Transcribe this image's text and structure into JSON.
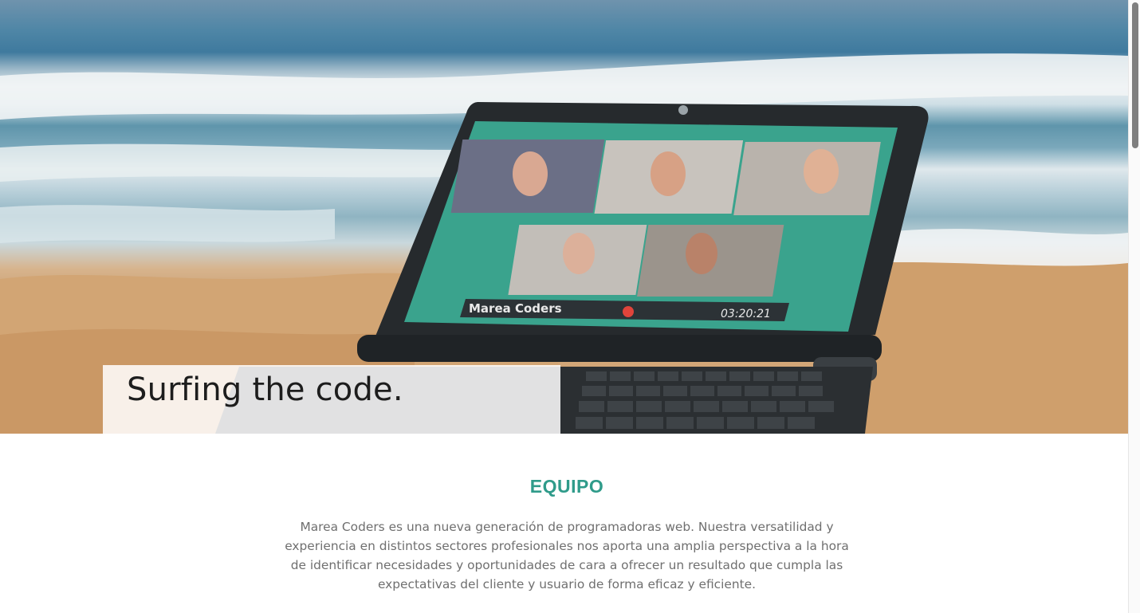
{
  "hero": {
    "title": "Surfing the code.",
    "screen_label": "Marea Coders",
    "screen_timer": "03:20:21",
    "image_description_icon": "laptop-on-beach-image"
  },
  "team": {
    "heading": "EQUIPO",
    "text": "Marea Coders es una nueva generación de programadoras web. Nuestra versatilidad y experiencia en distintos sectores profesionales nos aporta una amplia perspectiva a la hora de identificar necesidades y oportunidades de cara a ofrecer un resultado que cumpla las expectativas del cliente y usuario de forma eficaz y eficiente."
  },
  "colors": {
    "accent": "#2f9b8a",
    "text_muted": "#6f6f6f",
    "title": "#1d1d1d",
    "screen_teal": "#3aa38d"
  }
}
